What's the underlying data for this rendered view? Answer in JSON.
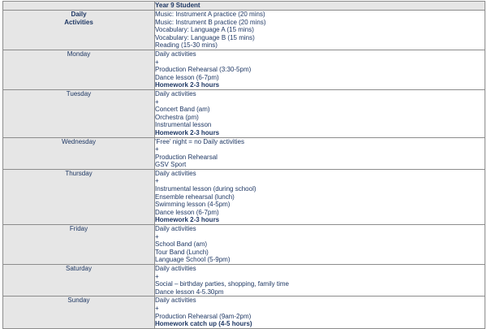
{
  "header": {
    "student": "Year 9 Student"
  },
  "daily": {
    "label_1": "Daily",
    "label_2": "Activities",
    "items": [
      "Music:  Instrument A practice (20 mins)",
      "Music:  Instrument B practice (20 mins)",
      "Vocabulary: Language A (15 mins)",
      "Vocabulary: Language B (15 mins)",
      "Reading (15-30 mins)"
    ]
  },
  "days": [
    {
      "name": "Monday",
      "lines": [
        {
          "text": "Daily activities",
          "bold": false
        },
        {
          "text": "+",
          "bold": false
        },
        {
          "text": "Production Rehearsal (3:30-5pm)",
          "bold": false
        },
        {
          "text": "Dance lesson (6-7pm)",
          "bold": false
        },
        {
          "text": "Homework 2-3 hours",
          "bold": true
        }
      ]
    },
    {
      "name": "Tuesday",
      "lines": [
        {
          "text": "Daily activities",
          "bold": false
        },
        {
          "text": "+",
          "bold": false
        },
        {
          "text": "Concert Band (am)",
          "bold": false
        },
        {
          "text": "Orchestra (pm)",
          "bold": false
        },
        {
          "text": "Instrumental lesson",
          "bold": false
        },
        {
          "text": "Homework 2-3 hours",
          "bold": true
        }
      ]
    },
    {
      "name": "Wednesday",
      "lines": [
        {
          "text": "'Free' night = no Daily activities",
          "bold": false
        },
        {
          "text": "+",
          "bold": false
        },
        {
          "text": "Production Rehearsal",
          "bold": false
        },
        {
          "text": "GSV Sport",
          "bold": false
        }
      ]
    },
    {
      "name": "Thursday",
      "lines": [
        {
          "text": "Daily activities",
          "bold": false
        },
        {
          "text": "+",
          "bold": false
        },
        {
          "text": "Instrumental lesson (during school)",
          "bold": false
        },
        {
          "text": "Ensemble rehearsal (lunch)",
          "bold": false
        },
        {
          "text": "Swimming lesson (4-5pm)",
          "bold": false
        },
        {
          "text": "Dance lesson (6-7pm)",
          "bold": false
        },
        {
          "text": "Homework 2-3 hours",
          "bold": true
        }
      ]
    },
    {
      "name": "Friday",
      "lines": [
        {
          "text": "Daily activities",
          "bold": false
        },
        {
          "text": "+",
          "bold": false
        },
        {
          "text": "School Band (am)",
          "bold": false
        },
        {
          "text": "Tour Band (Lunch)",
          "bold": false
        },
        {
          "text": "Language School (5-9pm)",
          "bold": false
        }
      ]
    },
    {
      "name": "Saturday",
      "lines": [
        {
          "text": "Daily activities",
          "bold": false
        },
        {
          "text": "+",
          "bold": false
        },
        {
          "text": "Social – birthday parties, shopping, family time",
          "bold": false
        },
        {
          "text": "Dance lesson 4-5.30pm",
          "bold": false
        }
      ]
    },
    {
      "name": "Sunday",
      "lines": [
        {
          "text": "Daily activities",
          "bold": false
        },
        {
          "text": "+",
          "bold": false
        },
        {
          "text": "Production Rehearsal (9am-2pm)",
          "bold": false
        },
        {
          "text": "Homework catch up (4-5 hours)",
          "bold": true
        }
      ]
    }
  ]
}
